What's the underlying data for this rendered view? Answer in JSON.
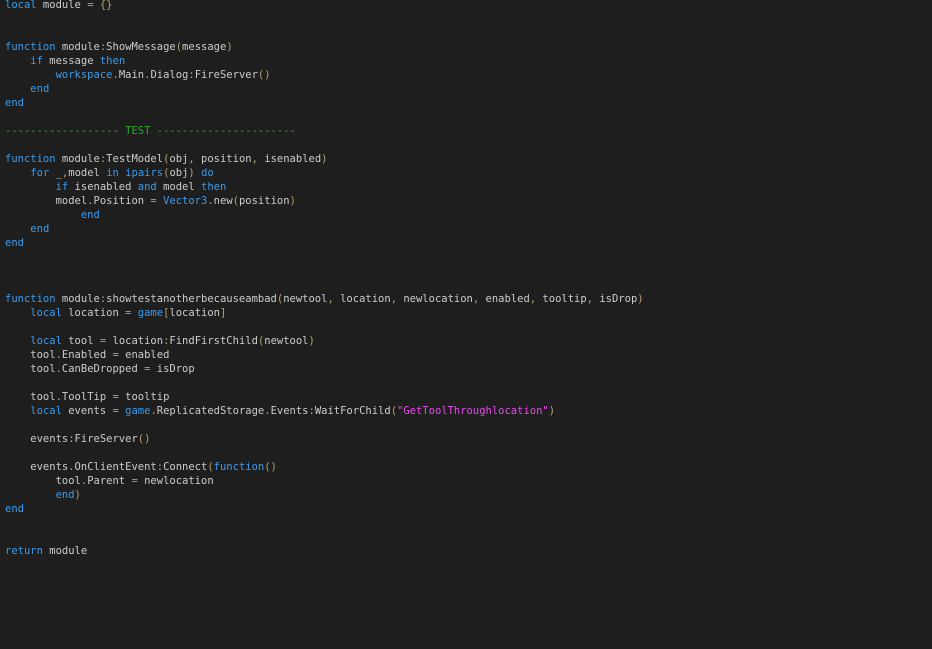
{
  "theme": {
    "background": "#1e1e1e",
    "keyword": "#3d9be9",
    "identifier": "#cccccc",
    "punctuation": "#b5a06a",
    "string": "#e24de7",
    "comment": "#2ea82e"
  },
  "lines": [
    [
      [
        "kw",
        "local"
      ],
      [
        "op",
        " module "
      ],
      [
        "pun",
        "="
      ],
      [
        "op",
        " "
      ],
      [
        "pun",
        "{}"
      ]
    ],
    [],
    [],
    [
      [
        "kw",
        "function"
      ],
      [
        "op",
        " module"
      ],
      [
        "pun",
        ":"
      ],
      [
        "id",
        "ShowMessage"
      ],
      [
        "pun",
        "("
      ],
      [
        "id",
        "message"
      ],
      [
        "pun",
        ")"
      ]
    ],
    [
      [
        "op",
        "    "
      ],
      [
        "kw",
        "if"
      ],
      [
        "op",
        " message "
      ],
      [
        "kw",
        "then"
      ]
    ],
    [
      [
        "op",
        "        "
      ],
      [
        "kw",
        "workspace"
      ],
      [
        "pun",
        "."
      ],
      [
        "id",
        "Main"
      ],
      [
        "pun",
        "."
      ],
      [
        "id",
        "Dialog"
      ],
      [
        "pun",
        ":"
      ],
      [
        "id",
        "FireServer"
      ],
      [
        "pun",
        "()"
      ]
    ],
    [
      [
        "op",
        "    "
      ],
      [
        "kw",
        "end"
      ]
    ],
    [
      [
        "kw",
        "end"
      ]
    ],
    [],
    [
      [
        "com",
        "------------------ TEST ----------------------"
      ]
    ],
    [],
    [
      [
        "kw",
        "function"
      ],
      [
        "op",
        " module"
      ],
      [
        "pun",
        ":"
      ],
      [
        "id",
        "TestModel"
      ],
      [
        "pun",
        "("
      ],
      [
        "id",
        "obj"
      ],
      [
        "pun",
        ","
      ],
      [
        "id",
        " position"
      ],
      [
        "pun",
        ","
      ],
      [
        "id",
        " isenabled"
      ],
      [
        "pun",
        ")"
      ]
    ],
    [
      [
        "op",
        "    "
      ],
      [
        "kw",
        "for"
      ],
      [
        "op",
        " _"
      ],
      [
        "pun",
        ","
      ],
      [
        "id",
        "model "
      ],
      [
        "kw",
        "in"
      ],
      [
        "op",
        " "
      ],
      [
        "kw",
        "ipairs"
      ],
      [
        "pun",
        "("
      ],
      [
        "id",
        "obj"
      ],
      [
        "pun",
        ")"
      ],
      [
        "op",
        " "
      ],
      [
        "kw",
        "do"
      ]
    ],
    [
      [
        "op",
        "        "
      ],
      [
        "kw",
        "if"
      ],
      [
        "op",
        " isenabled "
      ],
      [
        "kw",
        "and"
      ],
      [
        "op",
        " model "
      ],
      [
        "kw",
        "then"
      ]
    ],
    [
      [
        "op",
        "        model"
      ],
      [
        "pun",
        "."
      ],
      [
        "id",
        "Position "
      ],
      [
        "pun",
        "="
      ],
      [
        "op",
        " "
      ],
      [
        "kw",
        "Vector3"
      ],
      [
        "pun",
        "."
      ],
      [
        "id",
        "new"
      ],
      [
        "pun",
        "("
      ],
      [
        "id",
        "position"
      ],
      [
        "pun",
        ")"
      ]
    ],
    [
      [
        "op",
        "            "
      ],
      [
        "kw",
        "end"
      ]
    ],
    [
      [
        "op",
        "    "
      ],
      [
        "kw",
        "end"
      ]
    ],
    [
      [
        "kw",
        "end"
      ]
    ],
    [],
    [],
    [],
    [
      [
        "kw",
        "function"
      ],
      [
        "op",
        " module"
      ],
      [
        "pun",
        ":"
      ],
      [
        "id",
        "showtestanotherbecauseambad"
      ],
      [
        "pun",
        "("
      ],
      [
        "id",
        "newtool"
      ],
      [
        "pun",
        ","
      ],
      [
        "id",
        " location"
      ],
      [
        "pun",
        ","
      ],
      [
        "id",
        " newlocation"
      ],
      [
        "pun",
        ","
      ],
      [
        "id",
        " enabled"
      ],
      [
        "pun",
        ","
      ],
      [
        "id",
        " tooltip"
      ],
      [
        "pun",
        ","
      ],
      [
        "id",
        " isDrop"
      ],
      [
        "pun",
        ")"
      ]
    ],
    [
      [
        "op",
        "    "
      ],
      [
        "kw",
        "local"
      ],
      [
        "op",
        " location "
      ],
      [
        "pun",
        "="
      ],
      [
        "op",
        " "
      ],
      [
        "kw",
        "game"
      ],
      [
        "pun",
        "["
      ],
      [
        "id",
        "location"
      ],
      [
        "pun",
        "]"
      ]
    ],
    [],
    [
      [
        "op",
        "    "
      ],
      [
        "kw",
        "local"
      ],
      [
        "op",
        " tool "
      ],
      [
        "pun",
        "="
      ],
      [
        "op",
        " location"
      ],
      [
        "pun",
        ":"
      ],
      [
        "id",
        "FindFirstChild"
      ],
      [
        "pun",
        "("
      ],
      [
        "id",
        "newtool"
      ],
      [
        "pun",
        ")"
      ]
    ],
    [
      [
        "op",
        "    tool"
      ],
      [
        "pun",
        "."
      ],
      [
        "id",
        "Enabled "
      ],
      [
        "pun",
        "="
      ],
      [
        "op",
        " enabled"
      ]
    ],
    [
      [
        "op",
        "    tool"
      ],
      [
        "pun",
        "."
      ],
      [
        "id",
        "CanBeDropped "
      ],
      [
        "pun",
        "="
      ],
      [
        "op",
        " isDrop"
      ]
    ],
    [],
    [
      [
        "op",
        "    tool"
      ],
      [
        "pun",
        "."
      ],
      [
        "id",
        "ToolTip "
      ],
      [
        "pun",
        "="
      ],
      [
        "op",
        " tooltip"
      ]
    ],
    [
      [
        "op",
        "    "
      ],
      [
        "kw",
        "local"
      ],
      [
        "op",
        " events "
      ],
      [
        "pun",
        "="
      ],
      [
        "op",
        " "
      ],
      [
        "kw",
        "game"
      ],
      [
        "pun",
        "."
      ],
      [
        "id",
        "ReplicatedStorage"
      ],
      [
        "pun",
        "."
      ],
      [
        "id",
        "Events"
      ],
      [
        "pun",
        ":"
      ],
      [
        "id",
        "WaitForChild"
      ],
      [
        "pun",
        "("
      ],
      [
        "str",
        "\"GetToolThroughlocation\""
      ],
      [
        "pun",
        ")"
      ]
    ],
    [],
    [
      [
        "op",
        "    events"
      ],
      [
        "pun",
        ":"
      ],
      [
        "id",
        "FireServer"
      ],
      [
        "pun",
        "()"
      ]
    ],
    [],
    [
      [
        "op",
        "    events"
      ],
      [
        "pun",
        "."
      ],
      [
        "id",
        "OnClientEvent"
      ],
      [
        "pun",
        ":"
      ],
      [
        "id",
        "Connect"
      ],
      [
        "pun",
        "("
      ],
      [
        "kw",
        "function"
      ],
      [
        "pun",
        "()"
      ]
    ],
    [
      [
        "op",
        "        tool"
      ],
      [
        "pun",
        "."
      ],
      [
        "id",
        "Parent "
      ],
      [
        "pun",
        "="
      ],
      [
        "op",
        " newlocation"
      ]
    ],
    [
      [
        "op",
        "        "
      ],
      [
        "kw",
        "end"
      ],
      [
        "pun",
        ")"
      ]
    ],
    [
      [
        "kw",
        "end"
      ]
    ],
    [],
    [],
    [
      [
        "kw",
        "return"
      ],
      [
        "op",
        " module"
      ]
    ]
  ]
}
